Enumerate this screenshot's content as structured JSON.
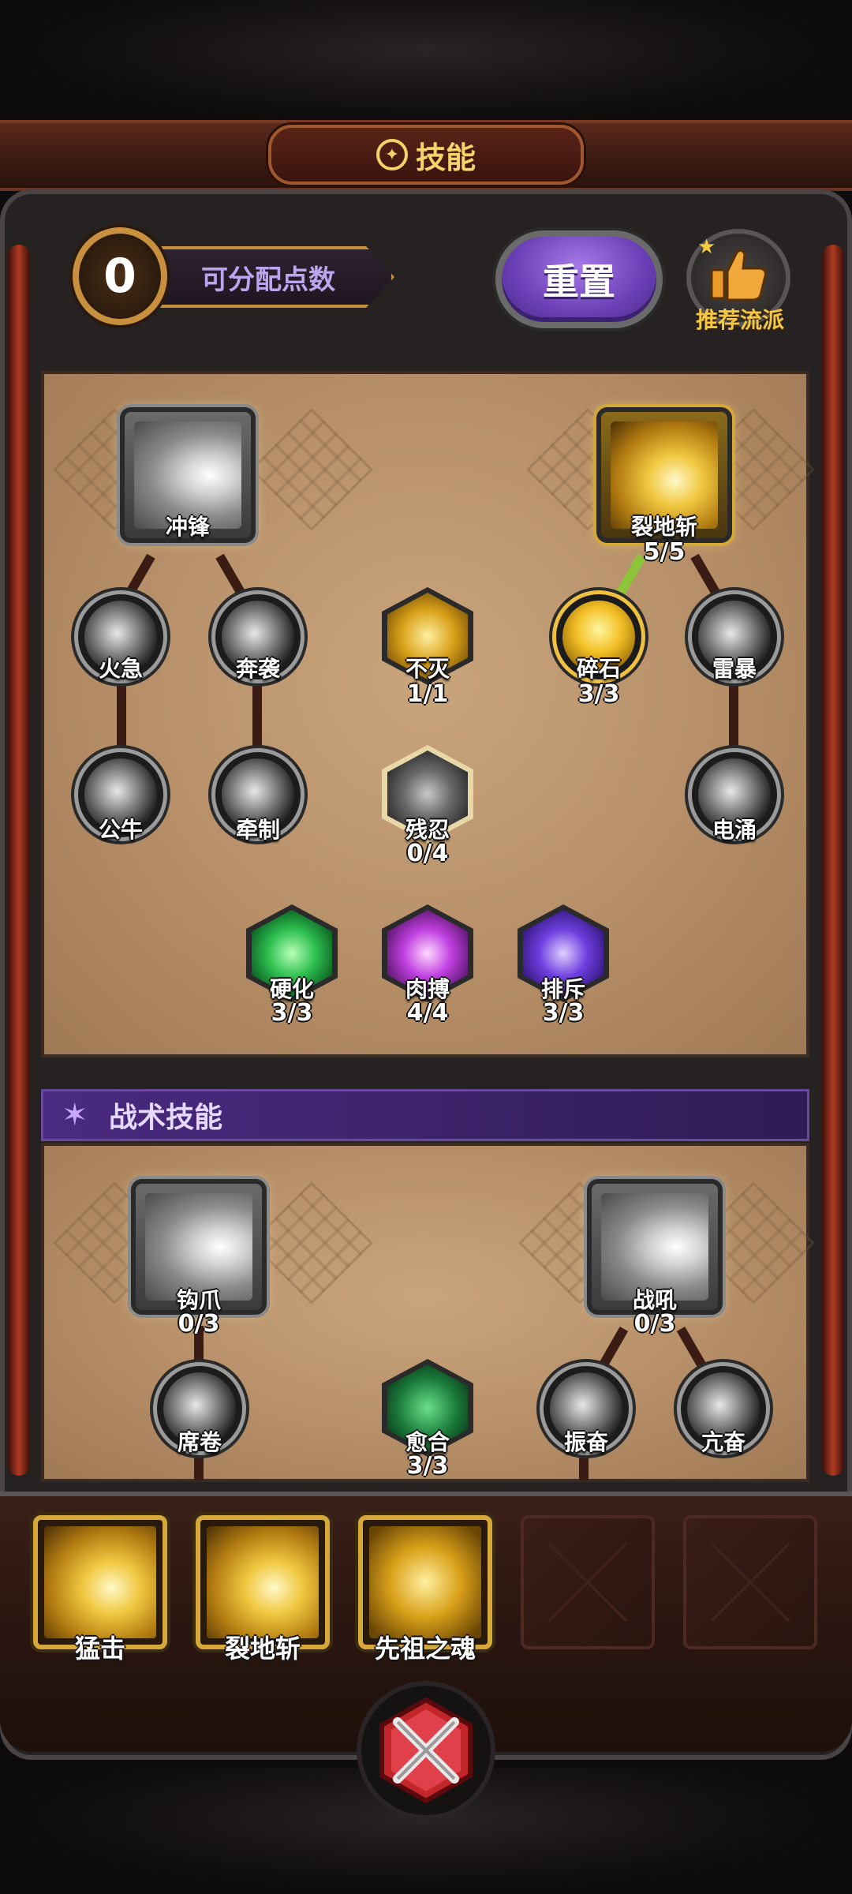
{
  "title": "技能",
  "header": {
    "points_value": "0",
    "points_label": "可分配点数",
    "reset_label": "重置",
    "recommend_label": "推荐流派"
  },
  "core_tree": {
    "nodes": [
      {
        "id": "chong-feng",
        "name": "冲锋",
        "count": ""
      },
      {
        "id": "lie-di-zhan",
        "name": "裂地斩",
        "count": "5/5"
      },
      {
        "id": "huo-ji",
        "name": "火急",
        "count": ""
      },
      {
        "id": "ben-xi",
        "name": "奔袭",
        "count": ""
      },
      {
        "id": "bu-mie",
        "name": "不灭",
        "count": "1/1"
      },
      {
        "id": "sui-shi",
        "name": "碎石",
        "count": "3/3"
      },
      {
        "id": "lei-bao",
        "name": "雷暴",
        "count": ""
      },
      {
        "id": "gong-niu",
        "name": "公牛",
        "count": ""
      },
      {
        "id": "qian-zhi",
        "name": "牵制",
        "count": ""
      },
      {
        "id": "can-ren",
        "name": "残忍",
        "count": "0/4"
      },
      {
        "id": "dian-yong",
        "name": "电涌",
        "count": ""
      },
      {
        "id": "ying-hua",
        "name": "硬化",
        "count": "3/3"
      },
      {
        "id": "rou-bo",
        "name": "肉搏",
        "count": "4/4"
      },
      {
        "id": "pai-chi",
        "name": "排斥",
        "count": "3/3"
      }
    ]
  },
  "tactical": {
    "header": "战术技能",
    "nodes": [
      {
        "id": "gou-zhao",
        "name": "钩爪",
        "count": "0/3"
      },
      {
        "id": "zhan-hou",
        "name": "战吼",
        "count": "0/3"
      },
      {
        "id": "xi-juan",
        "name": "席卷",
        "count": ""
      },
      {
        "id": "yu-he",
        "name": "愈合",
        "count": "3/3"
      },
      {
        "id": "zhen-fen",
        "name": "振奋",
        "count": ""
      },
      {
        "id": "kang-fen",
        "name": "亢奋",
        "count": ""
      }
    ]
  },
  "equipped_slots": [
    {
      "label": "猛击",
      "empty": false
    },
    {
      "label": "裂地斩",
      "empty": false
    },
    {
      "label": "先祖之魂",
      "empty": false
    },
    {
      "label": "",
      "empty": true
    },
    {
      "label": "",
      "empty": true
    }
  ],
  "icons": {
    "title": "gear-emblem-icon",
    "recommend": "thumbs-up-icon",
    "tactical": "star-icon",
    "close": "crossed-swords-close-icon"
  },
  "colors": {
    "gold_text": "#f5d26a",
    "reset_purple": "#6a3fb5",
    "tactical_purple": "#3a2266",
    "active_link_green": "#8dc43a"
  }
}
